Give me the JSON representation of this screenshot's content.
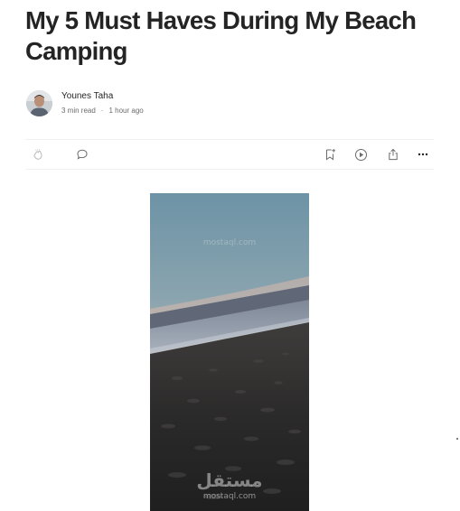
{
  "article": {
    "title": "My 5 Must Haves During My Beach Camping"
  },
  "author": {
    "name": "Younes Taha",
    "read_time": "3 min read",
    "separator": "·",
    "published": "1 hour ago"
  },
  "actions": {
    "icons": [
      "clap-icon",
      "comment-icon",
      "bookmark-add-icon",
      "play-icon",
      "share-icon",
      "more-icon"
    ]
  },
  "hero_image": {
    "watermark_brand": "مستقل",
    "watermark_domain": "mostaql.com"
  },
  "colors": {
    "text": "#242424",
    "meta": "#6b6b6b",
    "divider": "#f0f0f0",
    "icon": "#6b6b6b"
  }
}
